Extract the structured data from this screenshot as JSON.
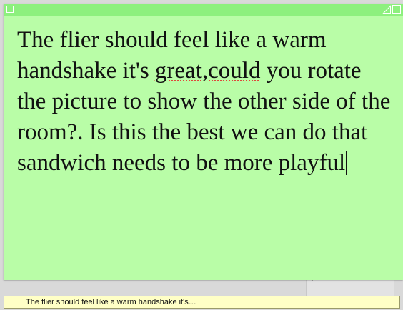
{
  "note": {
    "text_before": "The flier should feel like a warm handshake it's ",
    "misspelled": "great,could",
    "text_after": " you rotate the picture to show the other side of the room?. Is this the best we can do that sandwich needs to be more playful",
    "background_color": "#b9fda7",
    "titlebar_color": "#8df07e"
  },
  "titlebar": {
    "close_icon": "close-box-icon",
    "collapse_icon": "collapse-triangle-icon",
    "zoom_icon": "zoom-box-icon"
  },
  "background_window": {
    "label": "70"
  },
  "tooltip": {
    "text": "The flier should feel like a warm handshake it's…"
  }
}
